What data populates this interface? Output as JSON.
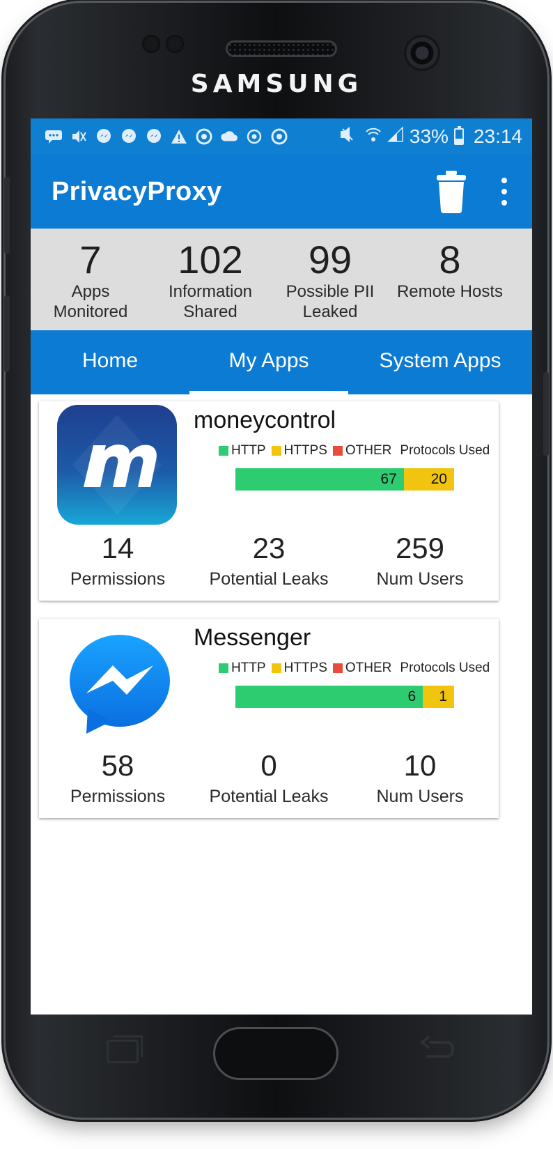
{
  "device": {
    "brand": "SAMSUNG"
  },
  "status_bar": {
    "icons": [
      "message-icon",
      "silent-icon",
      "messenger-icon",
      "messenger-icon",
      "messenger-icon",
      "warning-icon",
      "chrome-icon",
      "cloud-icon",
      "sync-icon",
      "chrome-icon"
    ],
    "right_icons": [
      "mute-icon",
      "wifi-icon",
      "signal-icon"
    ],
    "battery": "33%",
    "time": "23:14"
  },
  "app_bar": {
    "title": "PrivacyProxy",
    "actions": [
      "trash-icon",
      "more-vert-icon"
    ]
  },
  "summary": [
    {
      "value": "7",
      "label": "Apps\nMonitored"
    },
    {
      "value": "102",
      "label": "Information\nShared"
    },
    {
      "value": "99",
      "label": "Possible PII\nLeaked"
    },
    {
      "value": "8",
      "label": "Remote Hosts"
    }
  ],
  "tabs": [
    {
      "label": "Home",
      "selected": false
    },
    {
      "label": "My Apps",
      "selected": true
    },
    {
      "label": "System Apps",
      "selected": false
    }
  ],
  "legend": {
    "http": "HTTP",
    "https": "HTTPS",
    "other": "OTHER",
    "title": "Protocols Used",
    "colors": {
      "http": "#2ecc71",
      "https": "#f1c40f",
      "other": "#e74c3c"
    }
  },
  "apps": [
    {
      "name": "moneycontrol",
      "icon": "moneycontrol-logo",
      "protocols": {
        "http": 67,
        "https": 20,
        "other": 0
      },
      "http_label": "67",
      "https_label": "20",
      "permissions": "14",
      "permissions_label": "Permissions",
      "leaks": "23",
      "leaks_label": "Potential Leaks",
      "users": "259",
      "users_label": "Num Users"
    },
    {
      "name": "Messenger",
      "icon": "messenger-logo",
      "protocols": {
        "http": 6,
        "https": 1,
        "other": 0
      },
      "http_label": "6",
      "https_label": "1",
      "permissions": "58",
      "permissions_label": "Permissions",
      "leaks": "0",
      "leaks_label": "Potential Leaks",
      "users": "10",
      "users_label": "Num Users"
    }
  ],
  "colors": {
    "primary": "#0c7bd3",
    "status_bar": "#0e7fd1",
    "summary_bg": "#dddddd"
  }
}
